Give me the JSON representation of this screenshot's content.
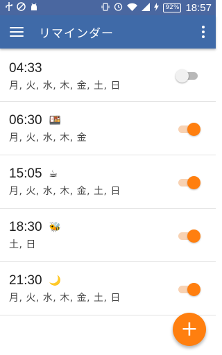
{
  "statusbar": {
    "icons_left": [
      "usb-icon",
      "no-wifi-calling-icon",
      "android-debug-icon"
    ],
    "icons_right": [
      "vibrate-icon",
      "alarm-icon",
      "wifi-icon",
      "signal-icon",
      "charging-icon"
    ],
    "battery": "92%",
    "clock": "18:57"
  },
  "appbar": {
    "title": "リマインダー",
    "menu_icon": "hamburger-menu-icon",
    "overflow_icon": "more-vert-icon"
  },
  "reminders": [
    {
      "time": "04:33",
      "emoji": "",
      "days": "月, 火, 水, 木, 金, 土, 日",
      "enabled": false
    },
    {
      "time": "06:30",
      "emoji": "🍱",
      "days": "月, 火, 水, 木, 金",
      "enabled": true
    },
    {
      "time": "15:05",
      "emoji": "☕",
      "days": "月, 火, 水, 木, 金, 土, 日",
      "enabled": true
    },
    {
      "time": "18:30",
      "emoji": "🐝",
      "days": "土, 日",
      "enabled": true
    },
    {
      "time": "21:30",
      "emoji": "🌙",
      "days": "月, 火, 水, 木, 金, 土, 日",
      "enabled": true
    }
  ],
  "fab": {
    "label": "+",
    "icon": "add-icon"
  },
  "colors": {
    "appbar": "#3f6aa8",
    "statusbar": "#4a67a0",
    "accent": "#ff7f0f"
  }
}
